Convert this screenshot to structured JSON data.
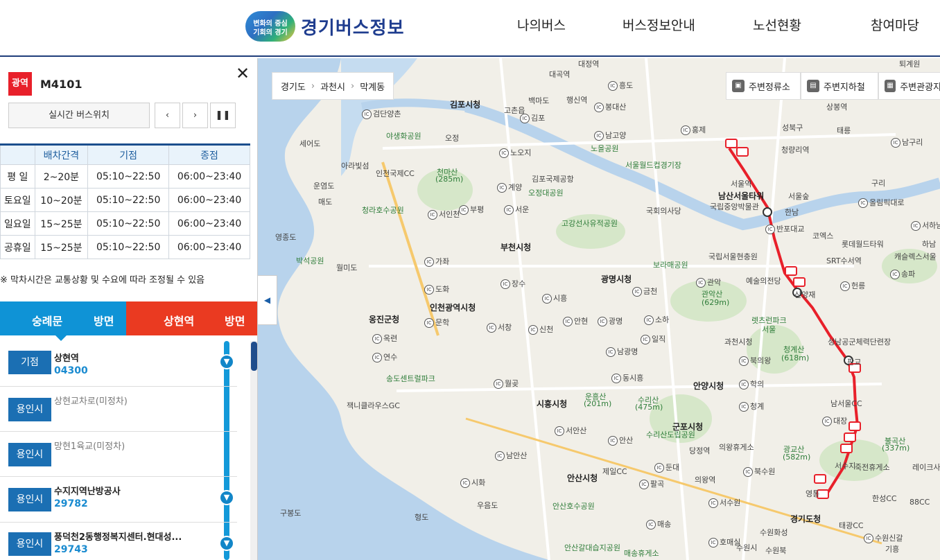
{
  "header": {
    "logo_line1": "변화의 중심",
    "logo_line2": "기회의 경기",
    "site_name": "경기버스정보",
    "nav": [
      "나의버스",
      "버스정보안내",
      "노선현황",
      "참여마당"
    ]
  },
  "route": {
    "badge": "광역",
    "number": "M4101",
    "close_icon": "close-icon",
    "realtime_label": "실시간 버스위치",
    "prev_label": "‹",
    "next_label": "›",
    "pause_label": "❚❚"
  },
  "schedule": {
    "headers": [
      "",
      "배차간격",
      "기점",
      "종점"
    ],
    "rows": [
      [
        "평 일",
        "2~20분",
        "05:10~22:50",
        "06:00~23:40"
      ],
      [
        "토요일",
        "10~20분",
        "05:10~22:50",
        "06:00~23:40"
      ],
      [
        "일요일",
        "15~25분",
        "05:10~22:50",
        "06:00~23:40"
      ],
      [
        "공휴일",
        "15~25분",
        "05:10~22:50",
        "06:00~23:40"
      ]
    ],
    "note": "※ 막차시간은 교통상황 및 수요에 따라 조정될 수 있음"
  },
  "direction": {
    "left_name": "숭례문",
    "left_suffix": "방면",
    "right_name": "상현역",
    "right_suffix": "방면",
    "left_color": "#0f93d6",
    "right_color": "#ea3a21"
  },
  "stops": [
    {
      "badge": "기점",
      "name": "상현역",
      "code": "04300"
    },
    {
      "badge": "용인시",
      "name": "상현교차로(미정차)",
      "code": ""
    },
    {
      "badge": "용인시",
      "name": "망현1육교(미정차)",
      "code": ""
    },
    {
      "badge": "용인시",
      "name": "수지지역난방공사",
      "code": "29782"
    },
    {
      "badge": "용인시",
      "name": "풍덕천2동행정복지센터.현대성...",
      "code": "29743"
    }
  ],
  "map": {
    "collapse_label": "◀",
    "breadcrumb": [
      "경기도",
      "과천시",
      "막계동"
    ],
    "nearby": [
      "주변정류소",
      "주변지하철",
      "주변관광지"
    ],
    "route_color": "#e8202a",
    "labels": {
      "north": [
        "대정역",
        "대곡역",
        "퇴계원",
        "흥도",
        "백마도",
        "행신역",
        "봉대산",
        "김포시청",
        "고촌읍",
        "김포",
        "남고양",
        "노을공원",
        "홍제",
        "성북구",
        "상봉역",
        "태릉",
        "검단양촌",
        "야생화공원",
        "오정",
        "노오지",
        "인천국제CC",
        "천마산",
        "(285m)",
        "계양",
        "김포국제공항",
        "오정대공원",
        "서울월드컵경기장",
        "서울역",
        "남산서울타워",
        "청량리역",
        "서울숲",
        "구리",
        "올림픽대로",
        "남구리",
        "세어도",
        "아라빛섬",
        "운염도",
        "매도",
        "청라호수공원",
        "서인천",
        "부평",
        "서운",
        "국회의사당",
        "국립중앙박물관",
        "한남",
        "반포대교",
        "코엑스",
        "롯데월드타워",
        "서하남",
        "하남",
        "영종도",
        "박석공원",
        "월미도",
        "고강선사유적공원",
        "부천시청",
        "보라매공원",
        "국립서울현충원",
        "SRT수서역",
        "캐슬렉스서울",
        "송파"
      ],
      "south": [
        "가좌",
        "도화",
        "장수",
        "광명시청",
        "금천",
        "관악",
        "예술의전당",
        "신양재",
        "헌릉",
        "인천광역시청",
        "옹진군청",
        "문학",
        "시흥",
        "안현",
        "광명",
        "소하",
        "일직",
        "관악산",
        "(629m)",
        "렛츠런파크",
        "서울",
        "과천시청",
        "청계산",
        "(618m)",
        "성남공군체력단련장",
        "옥련",
        "연수",
        "신천",
        "서창",
        "남광명",
        "북의왕",
        "판교",
        "송도센트럴파크",
        "동시흥",
        "안양시청",
        "학의",
        "운흥산",
        "(201m)",
        "수리산",
        "(475m)",
        "청계",
        "남서울CC",
        "잭니클라우스GC",
        "월곶",
        "시흥시청",
        "군포시청",
        "대장",
        "서안산",
        "안산",
        "수리산도립공원",
        "당정역",
        "의왕휴게소",
        "광교산",
        "(582m)",
        "불곡산",
        "(337m)",
        "남안산",
        "안산시청",
        "제일CC",
        "둔대",
        "북수원",
        "서수지",
        "죽전휴게소",
        "레이크사이드",
        "시화",
        "팔곡",
        "의왕역",
        "영통",
        "한성CC",
        "88CC",
        "구봉도",
        "형도",
        "우음도",
        "안산호수공원",
        "매송",
        "서수원",
        "경기도청",
        "수원화성",
        "태광CC",
        "수원신갈",
        "수원시",
        "수원북",
        "호매실",
        "매송휴게소",
        "안산갈대습지공원",
        "기흥"
      ]
    }
  }
}
